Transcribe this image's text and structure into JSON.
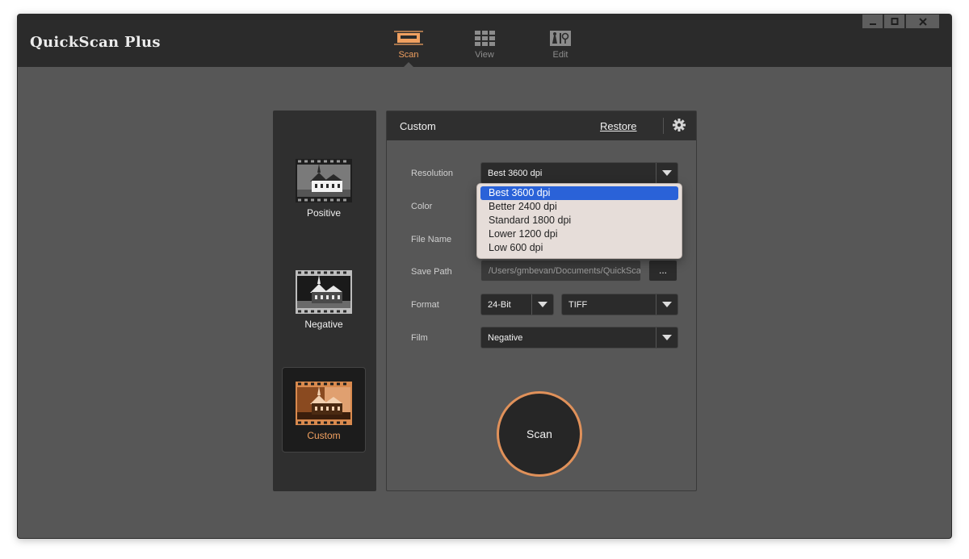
{
  "app": {
    "title": "QuickScan Plus"
  },
  "nav": {
    "tabs": [
      {
        "label": "Scan",
        "icon": "scanner-icon",
        "active": true
      },
      {
        "label": "View",
        "icon": "grid-icon",
        "active": false
      },
      {
        "label": "Edit",
        "icon": "edit-tools-icon",
        "active": false
      }
    ]
  },
  "film_types": [
    {
      "label": "Positive",
      "icon": "positive-film-icon",
      "selected": false
    },
    {
      "label": "Negative",
      "icon": "negative-film-icon",
      "selected": false
    },
    {
      "label": "Custom",
      "icon": "custom-film-icon",
      "selected": true
    }
  ],
  "settings": {
    "title": "Custom",
    "restore_label": "Restore",
    "labels": {
      "resolution": "Resolution",
      "color": "Color",
      "file_name": "File Name",
      "save_path": "Save Path",
      "format": "Format",
      "film": "Film"
    },
    "resolution_value": "Best 3600 dpi",
    "save_path_value": "/Users/gmbevan/Documents/QuickScan",
    "browse_label": "...",
    "bit_depth_value": "24-Bit",
    "file_format_value": "TIFF",
    "film_value": "Negative",
    "scan_label": "Scan"
  },
  "resolution_options": [
    "Best 3600 dpi",
    "Better 2400 dpi",
    "Standard 1800 dpi",
    "Lower 1200 dpi",
    "Low 600 dpi"
  ],
  "colors": {
    "accent": "#f0a060",
    "selection": "#2a62d8"
  }
}
